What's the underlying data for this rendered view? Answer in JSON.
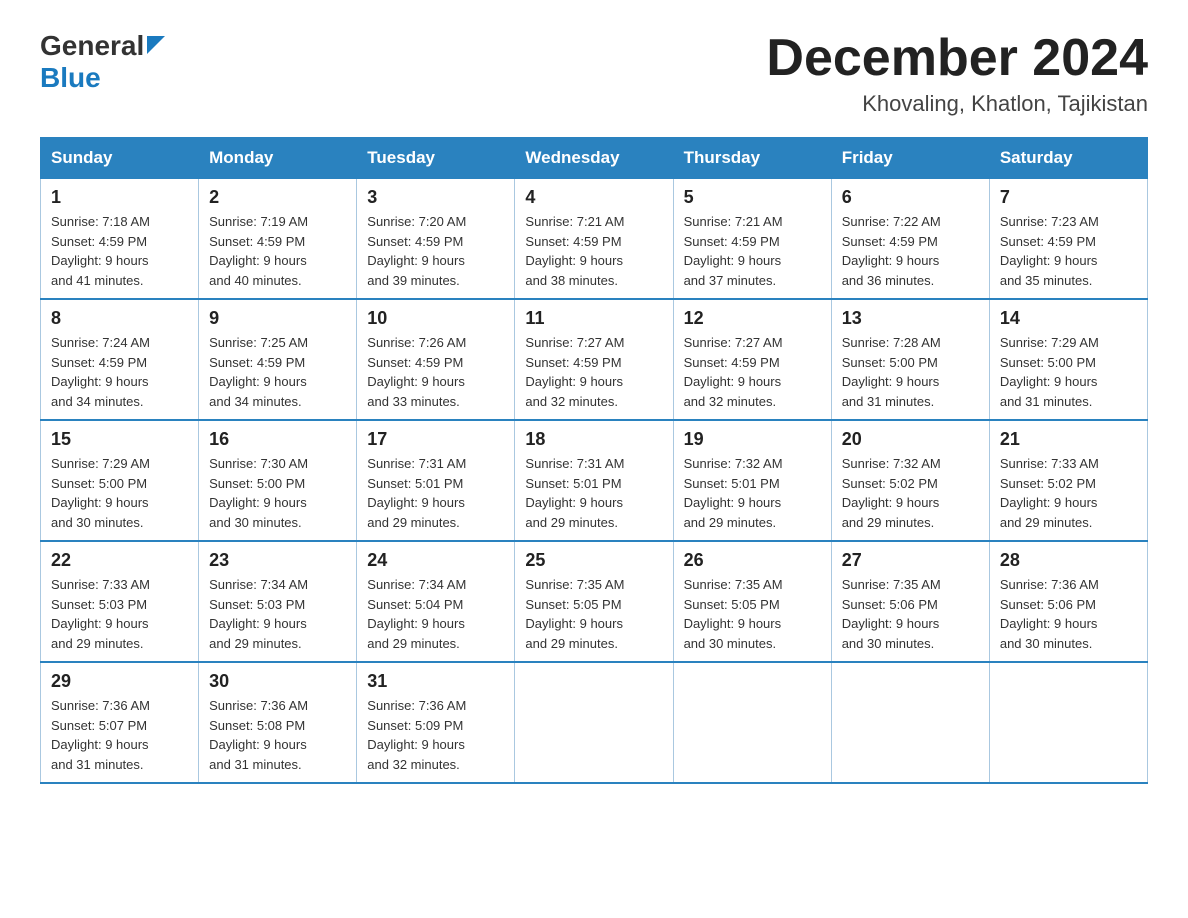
{
  "header": {
    "logo_line1": "General",
    "logo_line2": "Blue",
    "month_title": "December 2024",
    "location": "Khovaling, Khatlon, Tajikistan"
  },
  "days_of_week": [
    "Sunday",
    "Monday",
    "Tuesday",
    "Wednesday",
    "Thursday",
    "Friday",
    "Saturday"
  ],
  "weeks": [
    [
      {
        "day": "1",
        "sunrise": "7:18 AM",
        "sunset": "4:59 PM",
        "daylight": "9 hours and 41 minutes."
      },
      {
        "day": "2",
        "sunrise": "7:19 AM",
        "sunset": "4:59 PM",
        "daylight": "9 hours and 40 minutes."
      },
      {
        "day": "3",
        "sunrise": "7:20 AM",
        "sunset": "4:59 PM",
        "daylight": "9 hours and 39 minutes."
      },
      {
        "day": "4",
        "sunrise": "7:21 AM",
        "sunset": "4:59 PM",
        "daylight": "9 hours and 38 minutes."
      },
      {
        "day": "5",
        "sunrise": "7:21 AM",
        "sunset": "4:59 PM",
        "daylight": "9 hours and 37 minutes."
      },
      {
        "day": "6",
        "sunrise": "7:22 AM",
        "sunset": "4:59 PM",
        "daylight": "9 hours and 36 minutes."
      },
      {
        "day": "7",
        "sunrise": "7:23 AM",
        "sunset": "4:59 PM",
        "daylight": "9 hours and 35 minutes."
      }
    ],
    [
      {
        "day": "8",
        "sunrise": "7:24 AM",
        "sunset": "4:59 PM",
        "daylight": "9 hours and 34 minutes."
      },
      {
        "day": "9",
        "sunrise": "7:25 AM",
        "sunset": "4:59 PM",
        "daylight": "9 hours and 34 minutes."
      },
      {
        "day": "10",
        "sunrise": "7:26 AM",
        "sunset": "4:59 PM",
        "daylight": "9 hours and 33 minutes."
      },
      {
        "day": "11",
        "sunrise": "7:27 AM",
        "sunset": "4:59 PM",
        "daylight": "9 hours and 32 minutes."
      },
      {
        "day": "12",
        "sunrise": "7:27 AM",
        "sunset": "4:59 PM",
        "daylight": "9 hours and 32 minutes."
      },
      {
        "day": "13",
        "sunrise": "7:28 AM",
        "sunset": "5:00 PM",
        "daylight": "9 hours and 31 minutes."
      },
      {
        "day": "14",
        "sunrise": "7:29 AM",
        "sunset": "5:00 PM",
        "daylight": "9 hours and 31 minutes."
      }
    ],
    [
      {
        "day": "15",
        "sunrise": "7:29 AM",
        "sunset": "5:00 PM",
        "daylight": "9 hours and 30 minutes."
      },
      {
        "day": "16",
        "sunrise": "7:30 AM",
        "sunset": "5:00 PM",
        "daylight": "9 hours and 30 minutes."
      },
      {
        "day": "17",
        "sunrise": "7:31 AM",
        "sunset": "5:01 PM",
        "daylight": "9 hours and 29 minutes."
      },
      {
        "day": "18",
        "sunrise": "7:31 AM",
        "sunset": "5:01 PM",
        "daylight": "9 hours and 29 minutes."
      },
      {
        "day": "19",
        "sunrise": "7:32 AM",
        "sunset": "5:01 PM",
        "daylight": "9 hours and 29 minutes."
      },
      {
        "day": "20",
        "sunrise": "7:32 AM",
        "sunset": "5:02 PM",
        "daylight": "9 hours and 29 minutes."
      },
      {
        "day": "21",
        "sunrise": "7:33 AM",
        "sunset": "5:02 PM",
        "daylight": "9 hours and 29 minutes."
      }
    ],
    [
      {
        "day": "22",
        "sunrise": "7:33 AM",
        "sunset": "5:03 PM",
        "daylight": "9 hours and 29 minutes."
      },
      {
        "day": "23",
        "sunrise": "7:34 AM",
        "sunset": "5:03 PM",
        "daylight": "9 hours and 29 minutes."
      },
      {
        "day": "24",
        "sunrise": "7:34 AM",
        "sunset": "5:04 PM",
        "daylight": "9 hours and 29 minutes."
      },
      {
        "day": "25",
        "sunrise": "7:35 AM",
        "sunset": "5:05 PM",
        "daylight": "9 hours and 29 minutes."
      },
      {
        "day": "26",
        "sunrise": "7:35 AM",
        "sunset": "5:05 PM",
        "daylight": "9 hours and 30 minutes."
      },
      {
        "day": "27",
        "sunrise": "7:35 AM",
        "sunset": "5:06 PM",
        "daylight": "9 hours and 30 minutes."
      },
      {
        "day": "28",
        "sunrise": "7:36 AM",
        "sunset": "5:06 PM",
        "daylight": "9 hours and 30 minutes."
      }
    ],
    [
      {
        "day": "29",
        "sunrise": "7:36 AM",
        "sunset": "5:07 PM",
        "daylight": "9 hours and 31 minutes."
      },
      {
        "day": "30",
        "sunrise": "7:36 AM",
        "sunset": "5:08 PM",
        "daylight": "9 hours and 31 minutes."
      },
      {
        "day": "31",
        "sunrise": "7:36 AM",
        "sunset": "5:09 PM",
        "daylight": "9 hours and 32 minutes."
      },
      null,
      null,
      null,
      null
    ]
  ],
  "labels": {
    "sunrise": "Sunrise:",
    "sunset": "Sunset:",
    "daylight": "Daylight:"
  }
}
